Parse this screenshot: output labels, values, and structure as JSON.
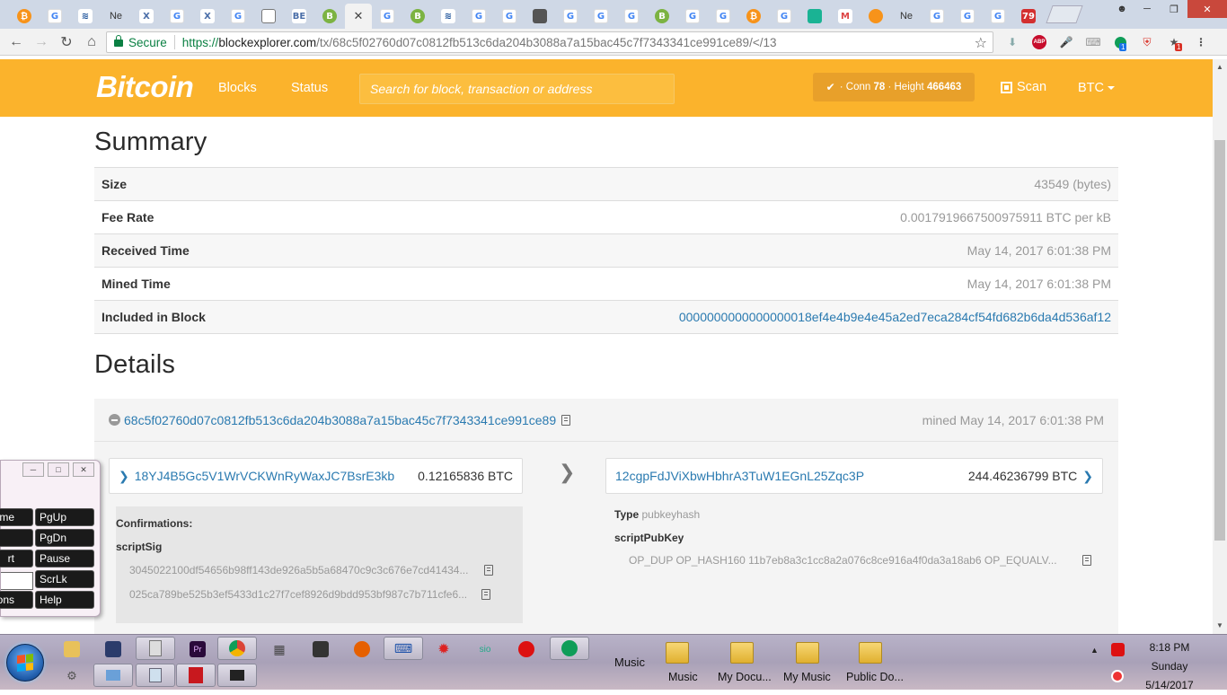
{
  "browser": {
    "tabs": [
      {
        "icon": "bitcoin-favicon",
        "glyph": "₿",
        "cls": "fav-btc",
        "title": ""
      },
      {
        "icon": "google-favicon",
        "glyph": "G",
        "cls": "fav-g",
        "title": ""
      },
      {
        "icon": "steem-favicon",
        "glyph": "≋",
        "cls": "fav-s",
        "title": ""
      },
      {
        "icon": "news-favicon",
        "glyph": "",
        "cls": "",
        "title": "Ne"
      },
      {
        "icon": "x-favicon",
        "glyph": "X",
        "cls": "fav-x",
        "title": ""
      },
      {
        "icon": "google-favicon",
        "glyph": "G",
        "cls": "fav-g",
        "title": ""
      },
      {
        "icon": "x-favicon",
        "glyph": "X",
        "cls": "fav-x",
        "title": ""
      },
      {
        "icon": "google-favicon",
        "glyph": "G",
        "cls": "fav-g",
        "title": ""
      },
      {
        "icon": "document-favicon",
        "glyph": "",
        "cls": "fav-doc",
        "title": ""
      },
      {
        "icon": "blockexplorer-favicon",
        "glyph": "BE",
        "cls": "fav-x",
        "title": ""
      },
      {
        "icon": "bitcoin-green-favicon",
        "glyph": "B",
        "cls": "fav-b",
        "title": ""
      }
    ],
    "tabs_after": [
      {
        "icon": "google-favicon",
        "glyph": "G",
        "cls": "fav-g",
        "title": ""
      },
      {
        "icon": "bitcoin-green-favicon",
        "glyph": "B",
        "cls": "fav-b",
        "title": ""
      },
      {
        "icon": "steem-favicon",
        "glyph": "≋",
        "cls": "fav-s",
        "title": ""
      },
      {
        "icon": "google-favicon",
        "glyph": "G",
        "cls": "fav-g",
        "title": ""
      },
      {
        "icon": "google-favicon",
        "glyph": "G",
        "cls": "fav-g",
        "title": ""
      },
      {
        "icon": "cube-favicon",
        "glyph": "",
        "cls": "fav-cube",
        "title": ""
      },
      {
        "icon": "google-favicon",
        "glyph": "G",
        "cls": "fav-g",
        "title": ""
      },
      {
        "icon": "google-favicon",
        "glyph": "G",
        "cls": "fav-g",
        "title": ""
      },
      {
        "icon": "google-favicon",
        "glyph": "G",
        "cls": "fav-g",
        "title": ""
      },
      {
        "icon": "bitcoin-green-favicon",
        "glyph": "B",
        "cls": "fav-b",
        "title": ""
      },
      {
        "icon": "google-favicon",
        "glyph": "G",
        "cls": "fav-g",
        "title": ""
      },
      {
        "icon": "google-favicon",
        "glyph": "G",
        "cls": "fav-g",
        "title": ""
      },
      {
        "icon": "bitcoin-favicon",
        "glyph": "₿",
        "cls": "fav-btc",
        "title": ""
      },
      {
        "icon": "google-favicon",
        "glyph": "G",
        "cls": "fav-g",
        "title": ""
      },
      {
        "icon": "teal-favicon",
        "glyph": "",
        "cls": "fav-teal",
        "title": ""
      },
      {
        "icon": "gmail-favicon",
        "glyph": "M",
        "cls": "fav-m",
        "title": ""
      },
      {
        "icon": "shield-favicon",
        "glyph": "",
        "cls": "fav-btc",
        "title": ""
      },
      {
        "icon": "news-favicon",
        "glyph": "",
        "cls": "",
        "title": "Ne"
      },
      {
        "icon": "google-favicon",
        "glyph": "G",
        "cls": "fav-g",
        "title": ""
      },
      {
        "icon": "google-favicon",
        "glyph": "G",
        "cls": "fav-g",
        "title": ""
      },
      {
        "icon": "google-favicon",
        "glyph": "G",
        "cls": "fav-g",
        "title": ""
      },
      {
        "icon": "counter-favicon",
        "glyph": "79",
        "cls": "fav-red",
        "title": ""
      }
    ],
    "active_close": "✕",
    "secure_label": "Secure",
    "url_scheme": "https://",
    "url_host": "blockexplorer.com",
    "url_path": "/tx/68c5f02760d07c0812fb513c6da204b3088a7a15bac45c7f7343341ce991ce89/</13",
    "ext_badge_1": "1",
    "ext_badge_2": "1"
  },
  "site": {
    "brand": "Bitcoin",
    "nav_blocks": "Blocks",
    "nav_status": "Status",
    "search_placeholder": "Search for block, transaction or address",
    "conn_prefix": "· Conn",
    "conn_value": "78",
    "height_label": "· Height",
    "height_value": "466463",
    "scan": "Scan",
    "currency": "BTC",
    "accent_color": "#fbb32c",
    "link_color": "#2a7ab0"
  },
  "summary": {
    "title": "Summary",
    "rows": [
      {
        "key": "Size",
        "value": "43549 (bytes)"
      },
      {
        "key": "Fee Rate",
        "value": "0.0017919667500975911 BTC per kB"
      },
      {
        "key": "Received Time",
        "value": "May 14, 2017 6:01:38 PM"
      },
      {
        "key": "Mined Time",
        "value": "May 14, 2017 6:01:38 PM"
      },
      {
        "key": "Included in Block",
        "value": "0000000000000000018ef4e4b9e4e45a2ed7eca284cf54fd682b6da4d536af12"
      }
    ]
  },
  "details": {
    "title": "Details",
    "txid": "68c5f02760d07c0812fb513c6da204b3088a7a15bac45c7f7343341ce991ce89",
    "mined": "mined May 14, 2017 6:01:38 PM",
    "input_address": "18YJ4B5Gc5V1WrVCKWnRyWaxJC7BsrE3kb",
    "input_amount": "0.12165836 BTC",
    "output_address": "12cgpFdJViXbwHbhrA3TuW1EGnL25Zqc3P",
    "output_amount": "244.46236799 BTC",
    "confirmations_label": "Confirmations:",
    "scriptsig_label": "scriptSig",
    "scriptsig_1": "3045022100df54656b98ff143de926a5b5a68470c9c3c676e7cd41434...",
    "scriptsig_2": "025ca789be525b3ef5433d1c27f7cef8926d9bdd953bf987c7b711cfe6...",
    "type_label": "Type",
    "type_value": "pubkeyhash",
    "scriptpubkey_label": "scriptPubKey",
    "scriptpubkey_value": "OP_DUP OP_HASH160 11b7eb8a3c1cc8a2a076c8ce916a4f0da3a18ab6 OP_EQUALV..."
  },
  "keyboard": {
    "keys": [
      {
        "label": "me",
        "col": 0,
        "row": 0
      },
      {
        "label": "PgUp",
        "col": 1,
        "row": 0
      },
      {
        "label": "",
        "col": 0,
        "row": 1
      },
      {
        "label": "PgDn",
        "col": 1,
        "row": 1
      },
      {
        "label": "rt",
        "col": 0,
        "row": 2
      },
      {
        "label": "Pause",
        "col": 1,
        "row": 2
      },
      {
        "label": "ScrLk",
        "col": 1,
        "row": 3
      },
      {
        "label": "ons",
        "col": 0,
        "row": 4
      },
      {
        "label": "Help",
        "col": 1,
        "row": 4
      }
    ]
  },
  "taskbar": {
    "music_label": "Music",
    "folders": [
      {
        "label": "Music"
      },
      {
        "label": "My Docu..."
      },
      {
        "label": "My Music"
      },
      {
        "label": "Public Do..."
      }
    ],
    "time": "8:18 PM",
    "day": "Sunday",
    "date": "5/14/2017"
  }
}
